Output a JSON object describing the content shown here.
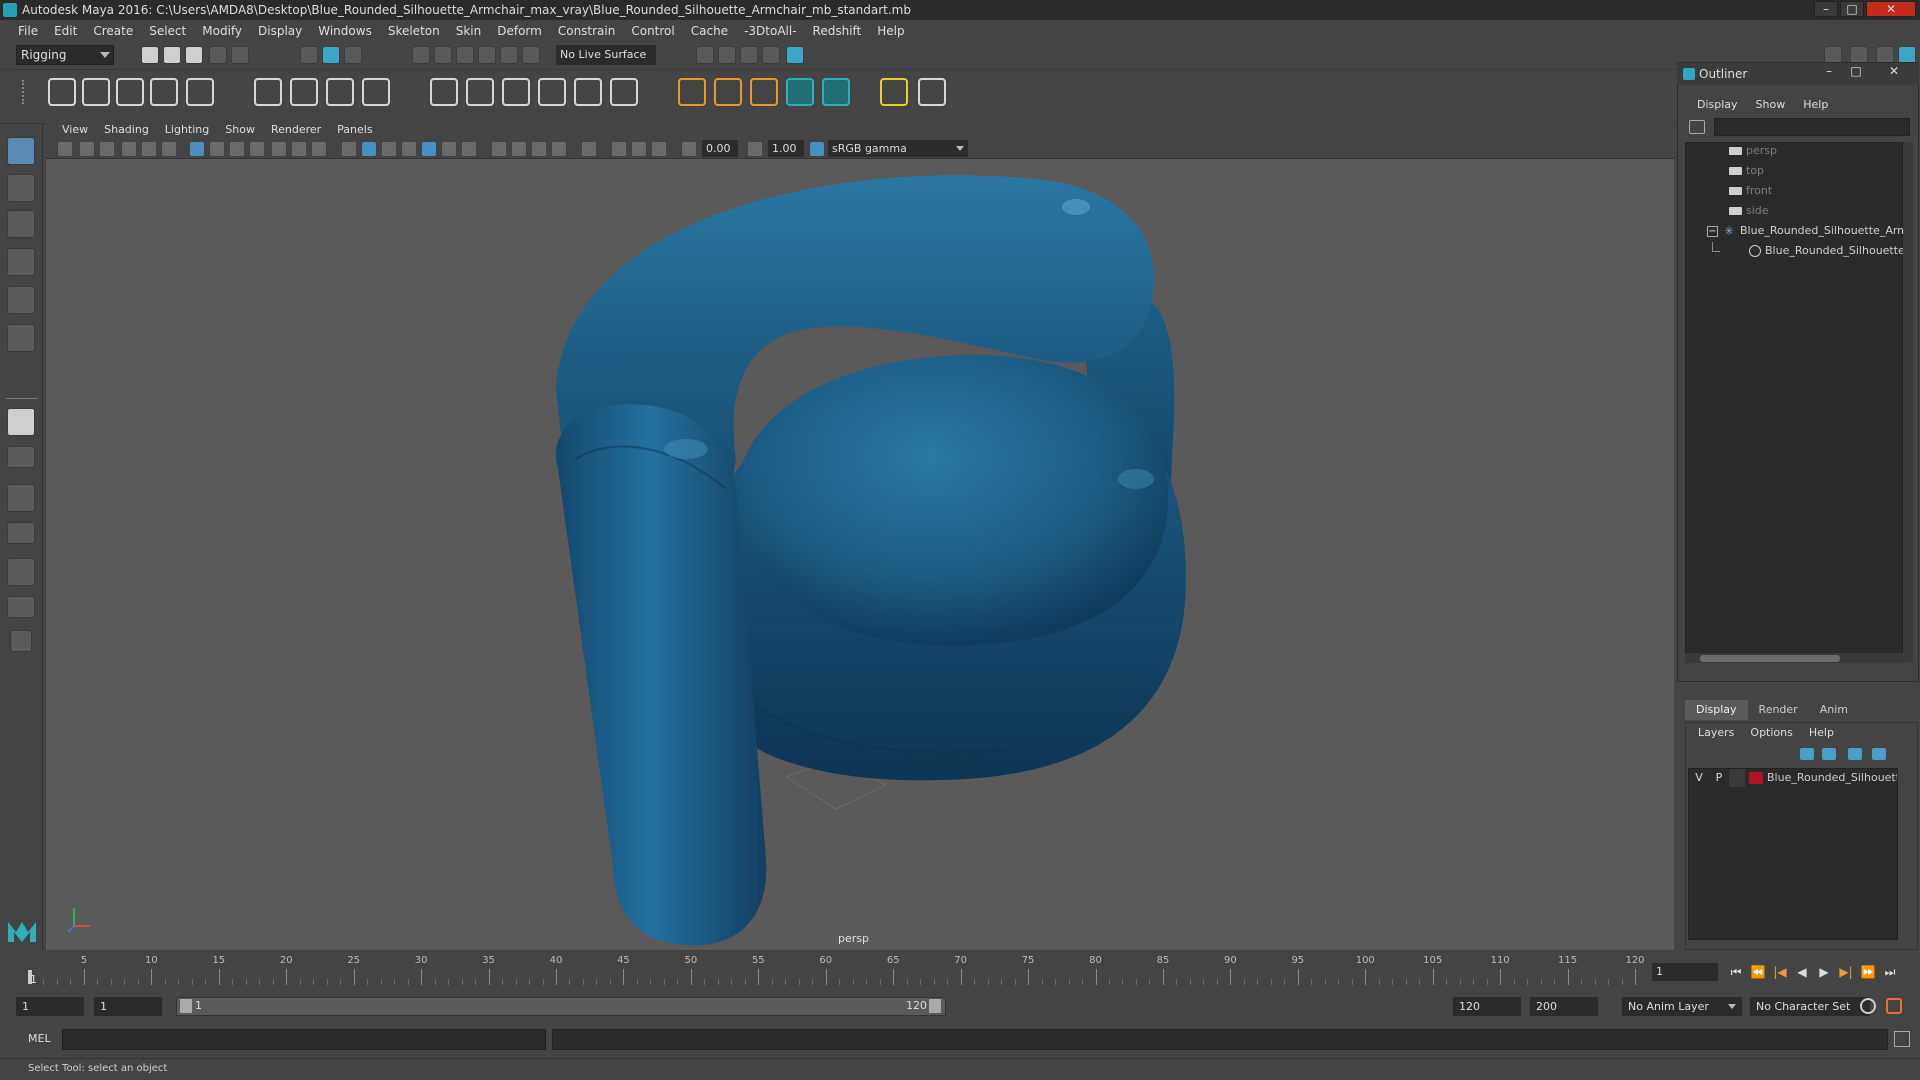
{
  "window": {
    "title": "Autodesk Maya 2016: C:\\Users\\AMDA8\\Desktop\\Blue_Rounded_Silhouette_Armchair_max_vray\\Blue_Rounded_Silhouette_Armchair_mb_standart.mb",
    "minimize": "–",
    "maximize": "□",
    "close": "✕"
  },
  "menubar": [
    "File",
    "Edit",
    "Create",
    "Select",
    "Modify",
    "Display",
    "Windows",
    "Skeleton",
    "Skin",
    "Deform",
    "Constrain",
    "Control",
    "Cache",
    "-3DtoAll-",
    "Redshift",
    "Help"
  ],
  "statusline": {
    "mode": "Rigging",
    "live_surface": "No Live Surface"
  },
  "viewport": {
    "menus": [
      "View",
      "Shading",
      "Lighting",
      "Show",
      "Renderer",
      "Panels"
    ],
    "exposure": "0.00",
    "gamma": "1.00",
    "color_space": "sRGB gamma",
    "camera_label": "persp"
  },
  "outliner": {
    "title": "Outliner",
    "menus": [
      "Display",
      "Show",
      "Help"
    ],
    "items": [
      {
        "label": "persp",
        "type": "camera"
      },
      {
        "label": "top",
        "type": "camera"
      },
      {
        "label": "front",
        "type": "camera"
      },
      {
        "label": "side",
        "type": "camera"
      },
      {
        "label": "Blue_Rounded_Silhouette_Armchair",
        "type": "group"
      },
      {
        "label": "Blue_Rounded_Silhouette_Armchair",
        "type": "mesh"
      }
    ]
  },
  "layer_editor": {
    "tabs": [
      "Display",
      "Render",
      "Anim"
    ],
    "active_tab": "Display",
    "menus": [
      "Layers",
      "Options",
      "Help"
    ],
    "layer": {
      "visible": "V",
      "playback": "P",
      "name": "Blue_Rounded_Silhouette_Armchair",
      "color": "#b0132a"
    }
  },
  "timeslider": {
    "ticks": [
      "5",
      "10",
      "15",
      "20",
      "25",
      "30",
      "35",
      "40",
      "45",
      "50",
      "55",
      "60",
      "65",
      "70",
      "75",
      "80",
      "85",
      "90",
      "95",
      "100",
      "105",
      "110",
      "115",
      "120"
    ],
    "current_frame": "1",
    "frame_field": "1",
    "playback_buttons": [
      "⏮",
      "⏪",
      "|◀",
      "◀",
      "▶",
      "▶|",
      "⏩",
      "⏭"
    ]
  },
  "range": {
    "start_field": "1",
    "playback_start": "1",
    "slider_start": "1",
    "slider_end": "120",
    "playback_end": "120",
    "end_field": "200",
    "anim_layer": "No Anim Layer",
    "character_set": "No Character Set"
  },
  "cmdline": {
    "language": "MEL"
  },
  "helpline": {
    "text": "Select Tool: select an object"
  },
  "colors": {
    "chair": "#1d5e86",
    "viewport_bg": "#5a5a5a",
    "accent": "#21a3b5"
  }
}
